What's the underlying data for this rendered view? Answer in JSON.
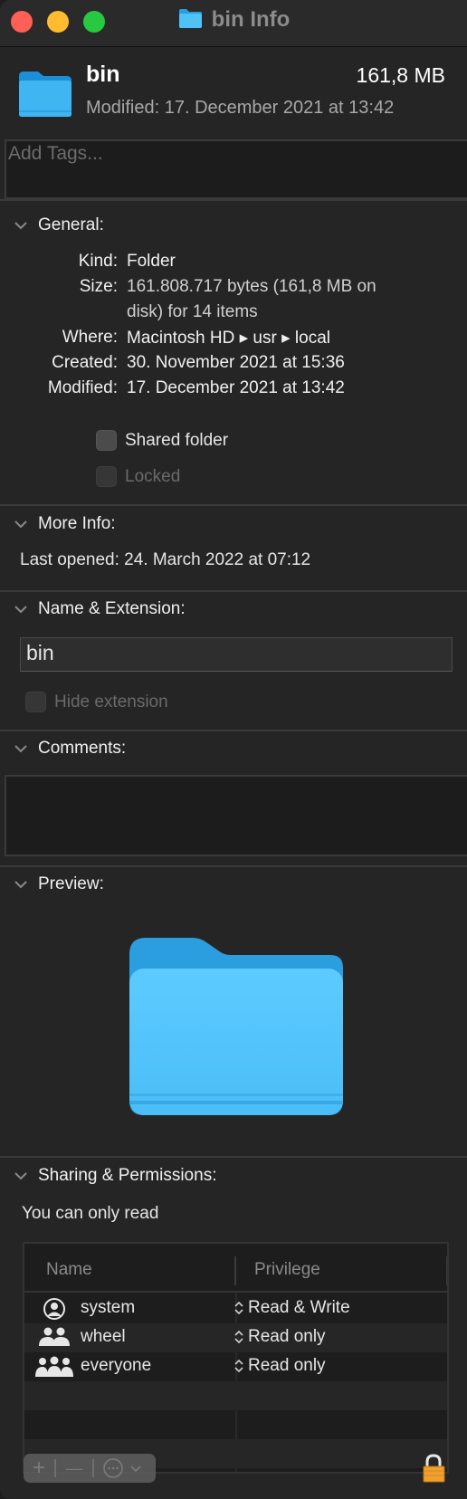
{
  "window": {
    "title": "bin Info",
    "traffic_lights": {
      "close": "#fe5f57",
      "minimize": "#febc2e",
      "zoom": "#28c840"
    }
  },
  "header": {
    "icon": "folder-icon",
    "name": "bin",
    "size": "161,8 MB",
    "modified": "Modified: 17. December 2021 at 13:42"
  },
  "tags": {
    "placeholder": "Add Tags..."
  },
  "general": {
    "title": "General:",
    "rows": [
      {
        "key": "Kind:",
        "value": "Folder"
      },
      {
        "key": "Size:",
        "value": "161.808.717 bytes (161,8 MB on",
        "value2": "disk) for 14 items"
      },
      {
        "key": "Where:",
        "value": "Macintosh HD ▸ usr ▸ local"
      },
      {
        "key": "Created:",
        "value": "30. November 2021 at 15:36"
      },
      {
        "key": "Modified:",
        "value": "17. December 2021 at 13:42"
      }
    ],
    "shared_folder": {
      "label": "Shared folder",
      "checked": false
    },
    "locked": {
      "label": "Locked",
      "checked": false,
      "disabled": true
    }
  },
  "more_info": {
    "title": "More Info:",
    "last_opened": "Last opened: 24. March 2022 at 07:12"
  },
  "name_extension": {
    "title": "Name & Extension:",
    "value": "bin",
    "hide_extension": {
      "label": "Hide extension",
      "checked": false,
      "disabled": true
    }
  },
  "comments": {
    "title": "Comments:",
    "value": ""
  },
  "preview": {
    "title": "Preview:",
    "icon": "folder-icon"
  },
  "sharing": {
    "title": "Sharing & Permissions:",
    "status": "You can only read",
    "columns": [
      "Name",
      "Privilege"
    ],
    "rows": [
      {
        "icon": "user-icon",
        "name": "system",
        "privilege": "Read & Write"
      },
      {
        "icon": "group-icon",
        "name": "wheel",
        "privilege": "Read only"
      },
      {
        "icon": "everyone-icon",
        "name": "everyone",
        "privilege": "Read only"
      }
    ],
    "buttons": {
      "add": "+",
      "remove": "—",
      "action": "⋯"
    }
  },
  "colors": {
    "accent_folder": "#4fc3f7",
    "lock": "#f0a030"
  }
}
